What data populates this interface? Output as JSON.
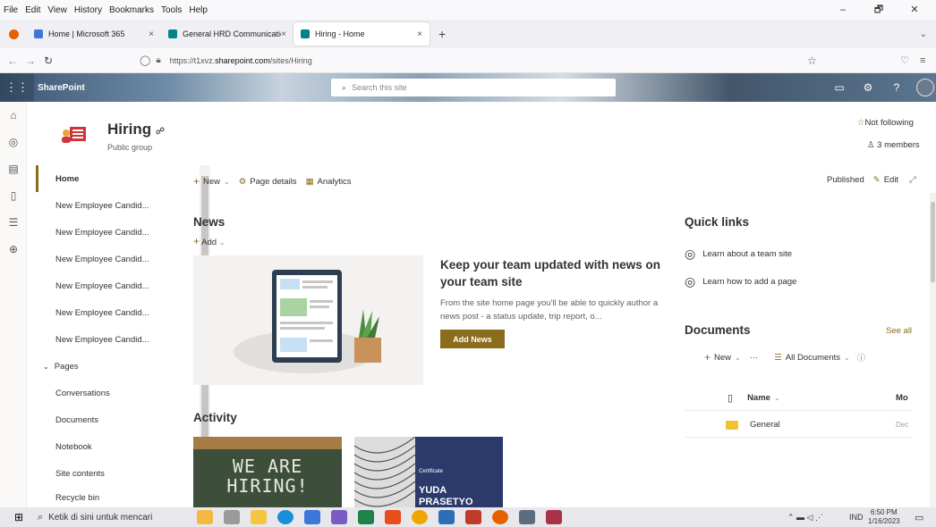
{
  "menu": [
    "File",
    "Edit",
    "View",
    "History",
    "Bookmarks",
    "Tools",
    "Help"
  ],
  "window_controls": [
    "–",
    "🗗",
    "✕"
  ],
  "tabs": [
    {
      "label": "Home | Microsoft 365",
      "close": "×"
    },
    {
      "label": "General HRD Communication S",
      "close": "×"
    },
    {
      "label": "Hiring - Home",
      "close": "×"
    }
  ],
  "new_tab": "+",
  "url": {
    "prefix": "https://t1xvz.",
    "domain": "sharepoint.com",
    "path": "/sites/Hiring"
  },
  "suite": {
    "app": "SharePoint",
    "search_placeholder": "Search this site"
  },
  "site": {
    "title": "Hiring",
    "subtitle": "Public group",
    "follow": "Not following",
    "members": "3 members"
  },
  "nav": {
    "items": [
      "Home",
      "New Employee Candid...",
      "New Employee Candid...",
      "New Employee Candid...",
      "New Employee Candid...",
      "New Employee Candid...",
      "New Employee Candid...",
      "Pages",
      "Conversations",
      "Documents",
      "Notebook",
      "Site contents",
      "Recycle bin"
    ]
  },
  "commandbar": {
    "new": "New",
    "page_details": "Page details",
    "analytics": "Analytics",
    "published": "Published",
    "edit": "Edit"
  },
  "news": {
    "heading": "News",
    "add": "Add",
    "promo_title": "Keep your team updated with news on your team site",
    "promo_body": "From the site home page you'll be able to quickly author a news post - a status update, trip report, o...",
    "button": "Add News"
  },
  "activity": {
    "heading": "Activity",
    "card1_text": "WE ARE HIRING!",
    "card2_label": "Certificate",
    "card2_name": "YUDA PRASETYO"
  },
  "quicklinks": {
    "heading": "Quick links",
    "links": [
      "Learn about a team site",
      "Learn how to add a page"
    ]
  },
  "documents": {
    "heading": "Documents",
    "see_all": "See all",
    "new": "New",
    "more": "···",
    "view": "All Documents",
    "col_name": "Name",
    "col_modified": "Mo",
    "rows": [
      {
        "name": "General",
        "modified": "Dec"
      }
    ]
  },
  "taskbar": {
    "search": "Ketik di sini untuk mencari",
    "time": "6:50 PM",
    "date": "1/16/2023",
    "lang": "IND"
  },
  "colors": {
    "accent": "#8a6d1c",
    "link": "#0078d4"
  }
}
